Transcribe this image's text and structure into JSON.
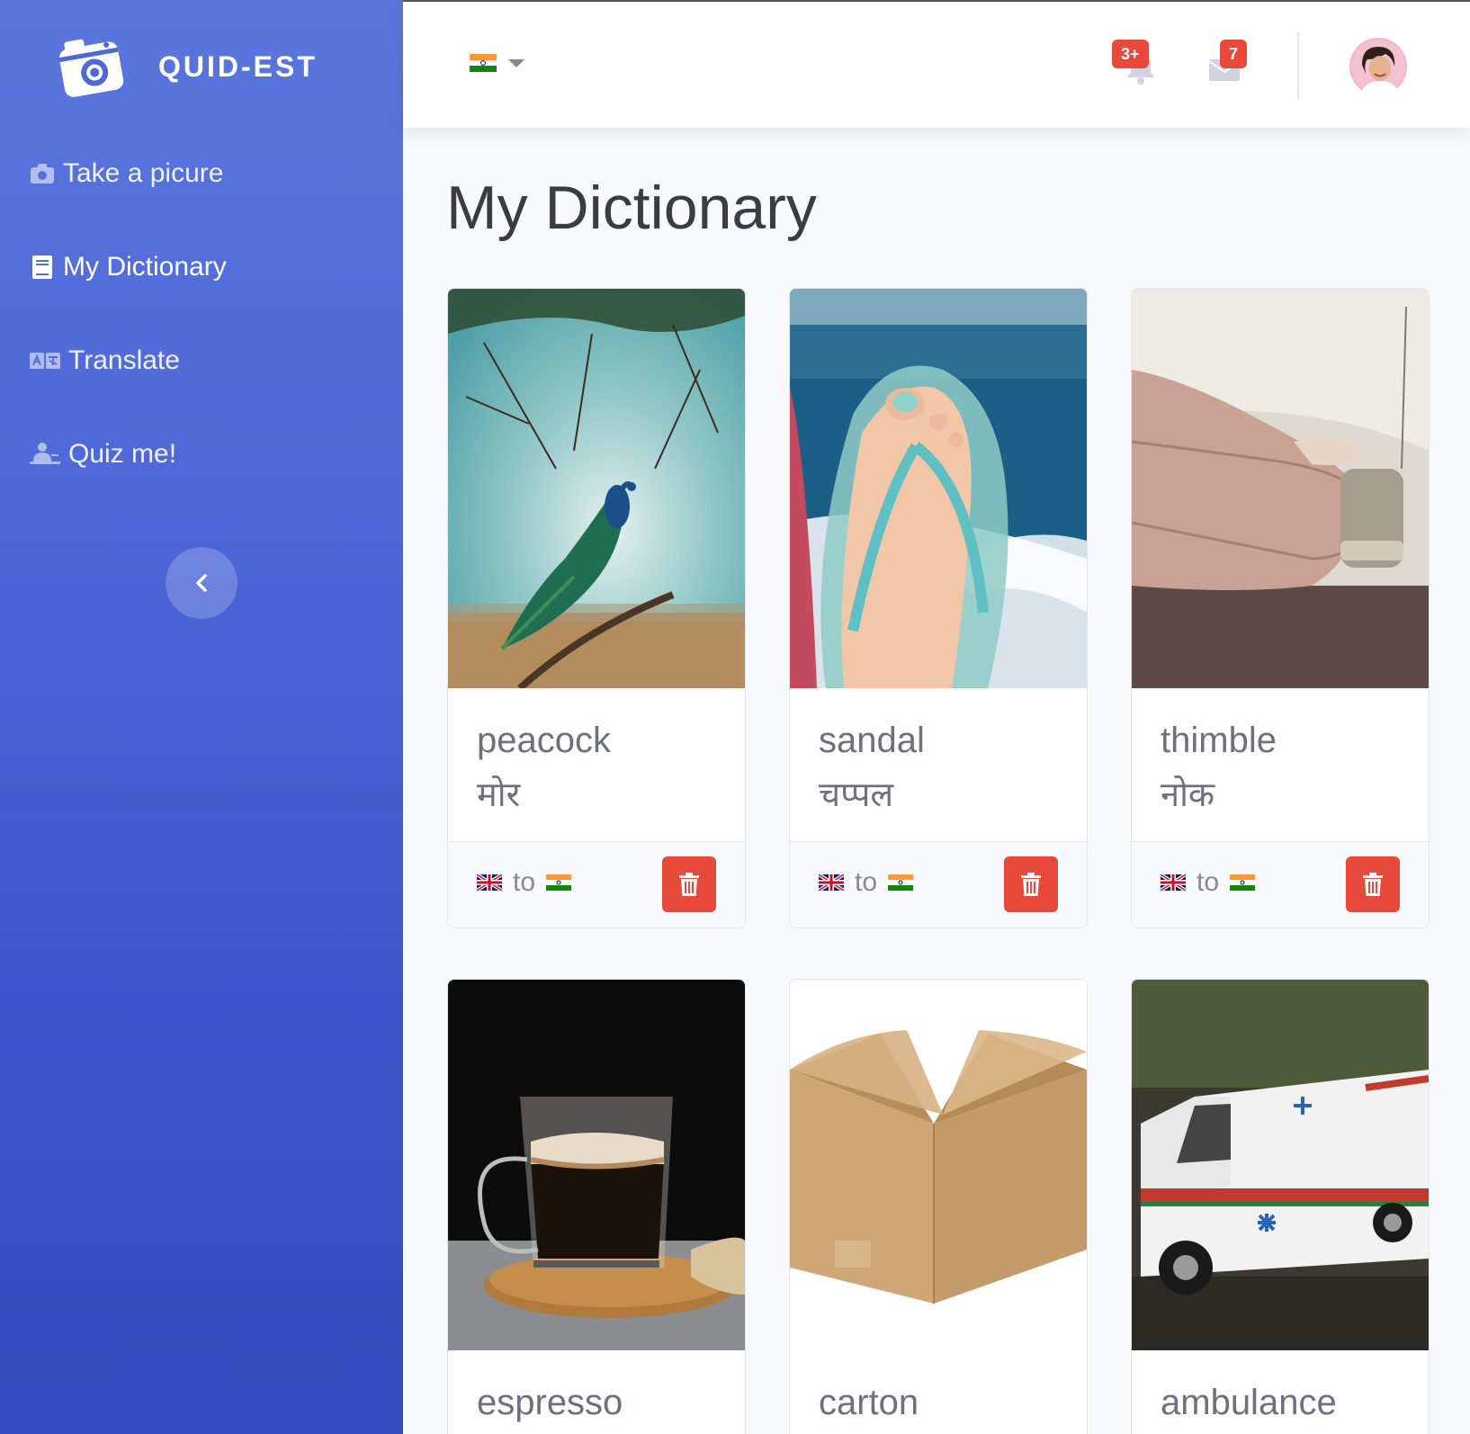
{
  "brand": {
    "name": "QUID-EST"
  },
  "sidebar": {
    "items": [
      {
        "label": "Take a picure",
        "icon": "camera-icon"
      },
      {
        "label": "My Dictionary",
        "icon": "book-icon"
      },
      {
        "label": "Translate",
        "icon": "language-icon"
      },
      {
        "label": "Quiz me!",
        "icon": "chalkboard-teacher-icon"
      }
    ],
    "active": "My Dictionary"
  },
  "topbar": {
    "selected_language_flag": "india-flag-icon",
    "alerts_badge": "3+",
    "messages_badge": "7"
  },
  "page": {
    "title": "My Dictionary"
  },
  "cards": [
    {
      "word": "peacock",
      "translation": "मोर",
      "from": "uk-flag-icon",
      "connector": "to",
      "to": "india-flag-icon",
      "image": "peacock-photo"
    },
    {
      "word": "sandal",
      "translation": "चप्पल",
      "from": "uk-flag-icon",
      "connector": "to",
      "to": "india-flag-icon",
      "image": "sandal-photo"
    },
    {
      "word": "thimble",
      "translation": "नोक",
      "from": "uk-flag-icon",
      "connector": "to",
      "to": "india-flag-icon",
      "image": "thimble-photo"
    },
    {
      "word": "espresso",
      "image": "espresso-photo"
    },
    {
      "word": "carton",
      "image": "carton-photo"
    },
    {
      "word": "ambulance",
      "image": "ambulance-photo"
    }
  ],
  "colors": {
    "sidebar_top": "#5a76dc",
    "sidebar_bottom": "#334dbf",
    "danger": "#e74a3b",
    "text": "#6e707e",
    "page_bg": "#f8f9fc"
  }
}
